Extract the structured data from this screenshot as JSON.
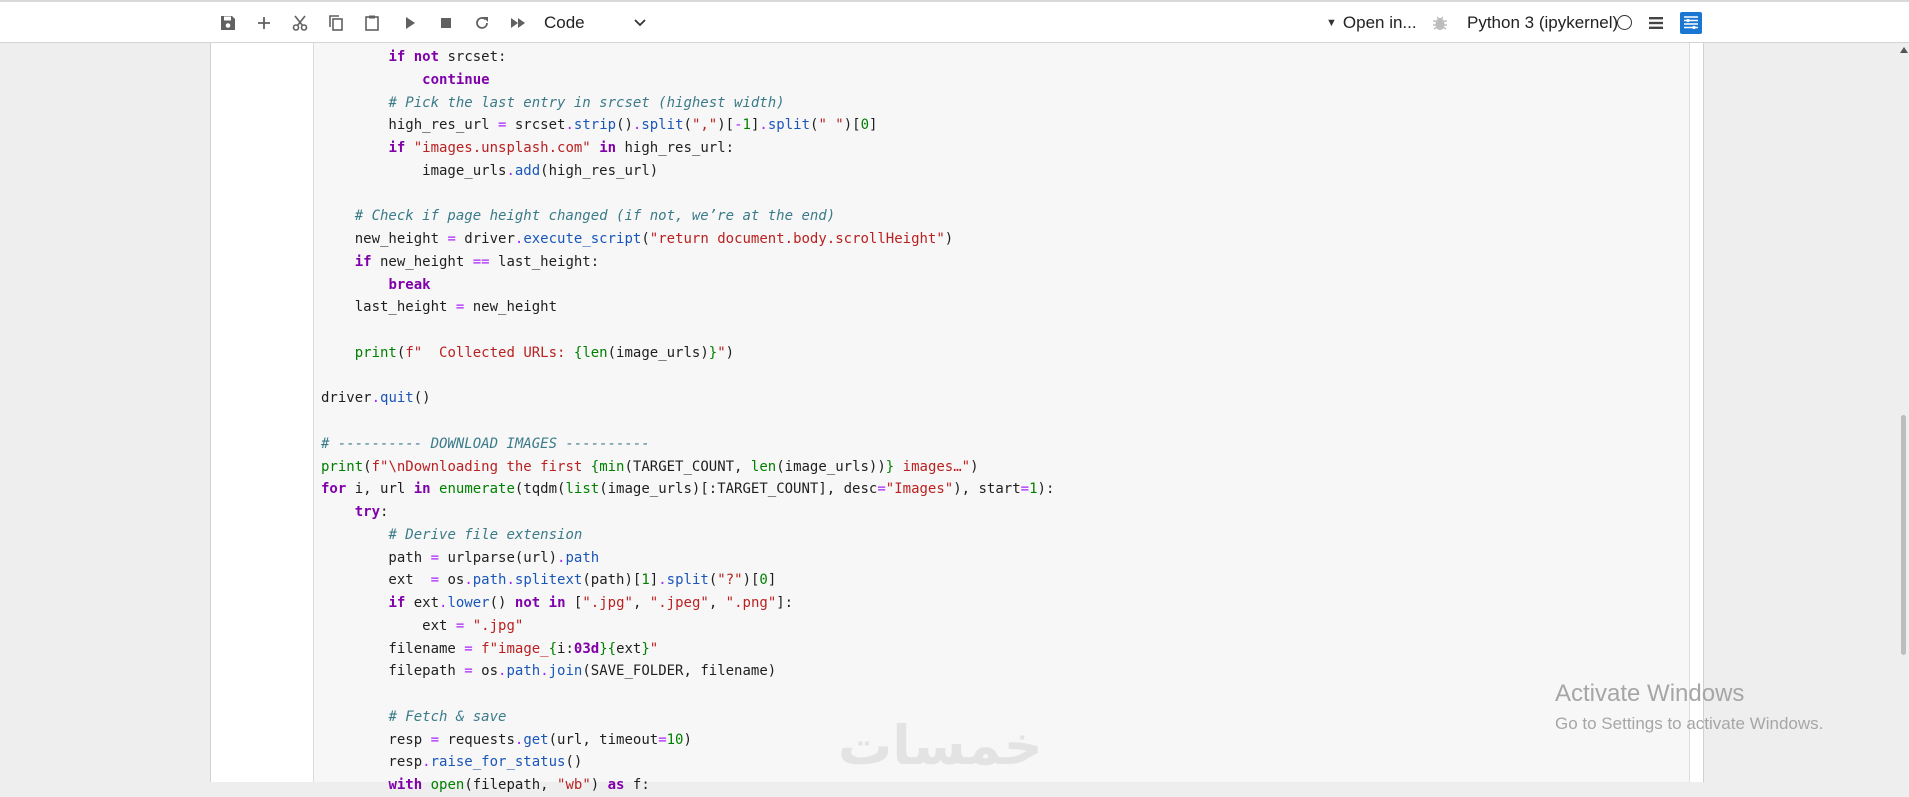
{
  "toolbar": {
    "cell_type": "Code",
    "open_in": "Open in...",
    "kernel": "Python 3 (ipykernel)",
    "icons": [
      "save-icon",
      "add-cell-icon",
      "cut-icon",
      "copy-icon",
      "paste-icon",
      "run-icon",
      "stop-icon",
      "restart-icon",
      "run-all-icon"
    ]
  },
  "code_lines": [
    "        if not srcset:",
    "            continue",
    "        # Pick the last entry in srcset (highest width)",
    "        high_res_url = srcset.strip().split(\",\")[-1].split(\" \")[0]",
    "        if \"images.unsplash.com\" in high_res_url:",
    "            image_urls.add(high_res_url)",
    "",
    "    # Check if page height changed (if not, we’re at the end)",
    "    new_height = driver.execute_script(\"return document.body.scrollHeight\")",
    "    if new_height == last_height:",
    "        break",
    "    last_height = new_height",
    "",
    "    print(f\"  Collected URLs: {len(image_urls)}\")",
    "",
    "driver.quit()",
    "",
    "# ---------- DOWNLOAD IMAGES ----------",
    "print(f\"\\nDownloading the first {min(TARGET_COUNT, len(image_urls))} images…\")",
    "for i, url in enumerate(tqdm(list(image_urls)[:TARGET_COUNT], desc=\"Images\"), start=1):",
    "    try:",
    "        # Derive file extension",
    "        path = urlparse(url).path",
    "        ext  = os.path.splitext(path)[1].split(\"?\")[0]",
    "        if ext.lower() not in [\".jpg\", \".jpeg\", \".png\"]:",
    "            ext = \".jpg\"",
    "        filename = f\"image_{i:03d}{ext}\"",
    "        filepath = os.path.join(SAVE_FOLDER, filename)",
    "",
    "        # Fetch & save",
    "        resp = requests.get(url, timeout=10)",
    "        resp.raise_for_status()",
    "        with open(filepath, \"wb\") as f:"
  ],
  "watermark": {
    "title": "Activate Windows",
    "subtitle": "Go to Settings to activate Windows."
  },
  "logo_text": "خمسات"
}
